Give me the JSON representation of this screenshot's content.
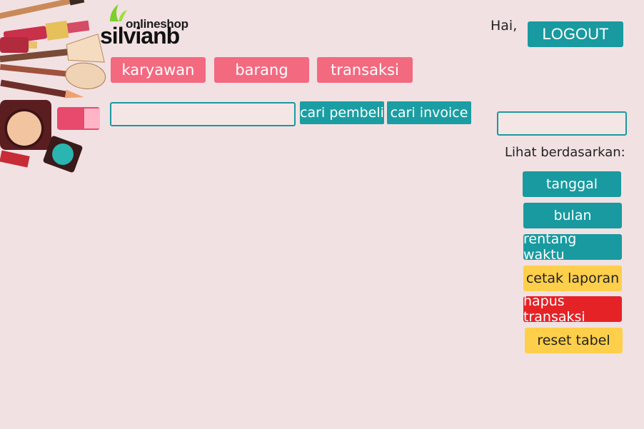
{
  "brand": {
    "top": "onlineshop",
    "name": "silvianb"
  },
  "header": {
    "greeting": "Hai,",
    "logout_label": "LOGOUT"
  },
  "tabs": [
    {
      "label": "karyawan"
    },
    {
      "label": "barang"
    },
    {
      "label": "transaksi"
    }
  ],
  "search": {
    "placeholder": "",
    "buyer_button": "cari pembeli",
    "invoice_button": "cari invoice"
  },
  "filter": {
    "input_placeholder": "",
    "label": "Lihat berdasarkan:",
    "buttons": {
      "tanggal": "tanggal",
      "bulan": "bulan",
      "rentang": "rentang waktu",
      "cetak": "cetak laporan",
      "hapus": "hapus transaksi",
      "reset": "reset tabel"
    }
  },
  "colors": {
    "teal": "#189aa0",
    "pink": "#f36a80",
    "yellow": "#fecf4a",
    "red": "#e52327",
    "background": "#f2e1e2"
  }
}
